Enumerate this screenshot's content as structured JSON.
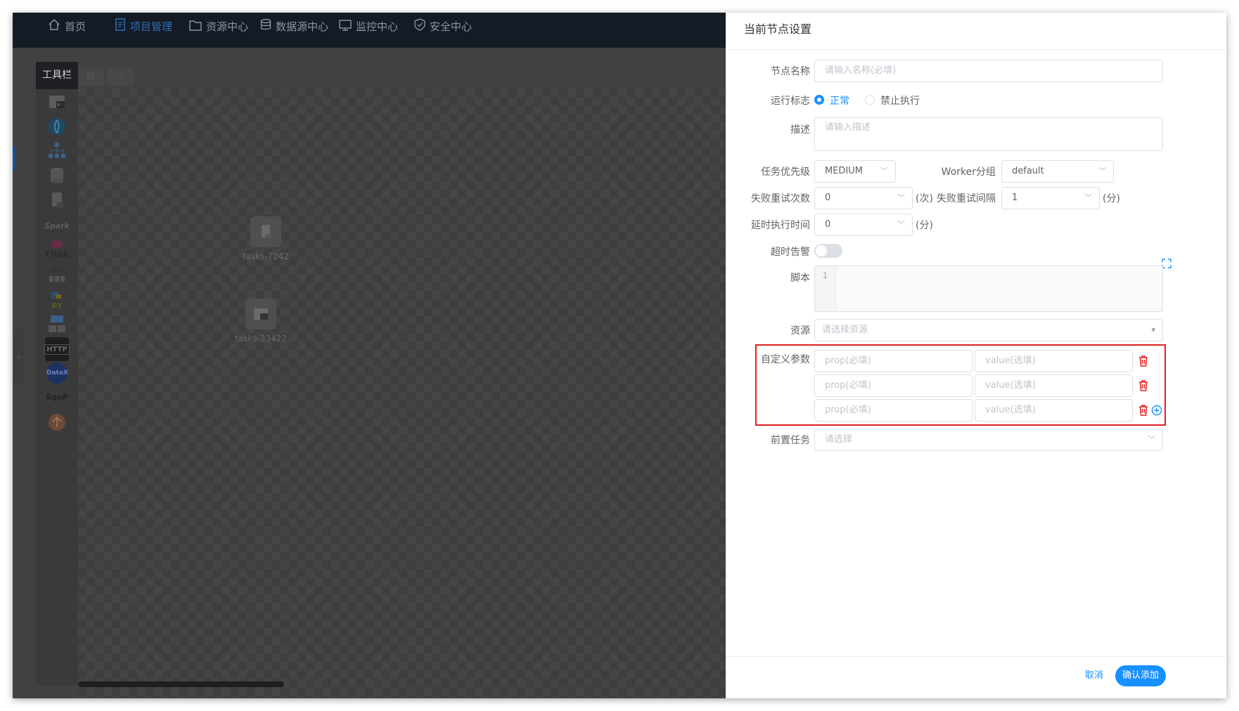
{
  "nav": {
    "items": [
      {
        "label": "首页",
        "icon": "home-icon"
      },
      {
        "label": "项目管理",
        "icon": "document-icon",
        "active": true
      },
      {
        "label": "资源中心",
        "icon": "folder-icon"
      },
      {
        "label": "数据源中心",
        "icon": "database-icon"
      },
      {
        "label": "监控中心",
        "icon": "monitor-icon"
      },
      {
        "label": "安全中心",
        "icon": "shield-icon"
      }
    ]
  },
  "toolbar": {
    "title": "工具栏",
    "tools": [
      "SHELL",
      "SUB_PROCESS",
      "PROCEDURE",
      "SQL",
      "DEPENDENT",
      "SPARK",
      "FLINK",
      "MR",
      "PYTHON",
      "CONDITIONS",
      "HTTP",
      "DATAX",
      "SQOOP",
      "SWITCH"
    ],
    "flink_label": "Flink",
    "mr_label": "MR",
    "py_label": "py",
    "http_label": "HTTP",
    "datax_label": "DataX",
    "sqoop_label": "SqoP",
    "spark_label": "Spark"
  },
  "canvas": {
    "nodes": [
      {
        "name": "tasks-7242",
        "type": "SQL"
      },
      {
        "name": "tasks-33422",
        "type": "SHELL"
      }
    ]
  },
  "drawer": {
    "title": "当前节点设置",
    "node_name": {
      "label": "节点名称",
      "placeholder": "请输入名称(必填)"
    },
    "run_flag": {
      "label": "运行标志",
      "option_normal": "正常",
      "option_forbidden": "禁止执行",
      "selected": "正常"
    },
    "description": {
      "label": "描述",
      "placeholder": "请输入描述"
    },
    "priority": {
      "label": "任务优先级",
      "value": "MEDIUM"
    },
    "worker_group": {
      "label": "Worker分组",
      "value": "default"
    },
    "retry_times": {
      "label": "失败重试次数",
      "value": "0",
      "unit": "(次)"
    },
    "retry_interval": {
      "label": "失败重试间隔",
      "value": "1",
      "unit": "(分)"
    },
    "delay_time": {
      "label": "延时执行时间",
      "value": "0",
      "unit": "(分)"
    },
    "timeout_alarm": {
      "label": "超时告警",
      "enabled": false
    },
    "script": {
      "label": "脚本",
      "line_number": "1"
    },
    "resources": {
      "label": "资源",
      "placeholder": "请选择资源"
    },
    "custom_params": {
      "label": "自定义参数",
      "prop_placeholder": "prop(必填)",
      "value_placeholder": "value(选填)",
      "rows": 3
    },
    "pre_tasks": {
      "label": "前置任务",
      "placeholder": "请选择"
    },
    "cancel_label": "取消",
    "confirm_label": "确认添加"
  },
  "colors": {
    "primary": "#1890ff",
    "danger": "#e02020",
    "nav_bg": "#151b25"
  }
}
